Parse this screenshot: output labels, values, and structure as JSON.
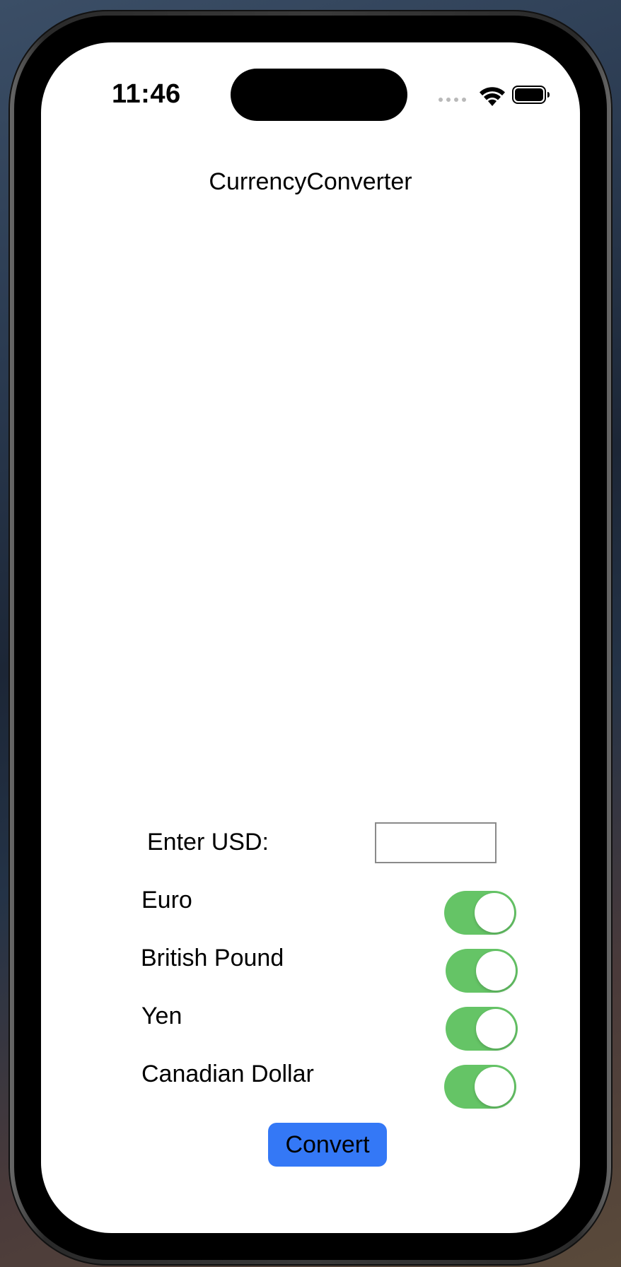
{
  "status_bar": {
    "time": "11:46",
    "icons": [
      "cellular-signal-icon",
      "wifi-icon",
      "battery-icon"
    ]
  },
  "app": {
    "title": "CurrencyConverter"
  },
  "form": {
    "usd_label": "Enter USD:",
    "usd_value": "",
    "currencies": [
      {
        "label": "Euro",
        "enabled": true
      },
      {
        "label": "British Pound",
        "enabled": true
      },
      {
        "label": "Yen",
        "enabled": true
      },
      {
        "label": "Canadian Dollar",
        "enabled": true
      }
    ],
    "convert_label": "Convert"
  },
  "colors": {
    "toggle_on": "#65c466",
    "button": "#3478f6"
  }
}
